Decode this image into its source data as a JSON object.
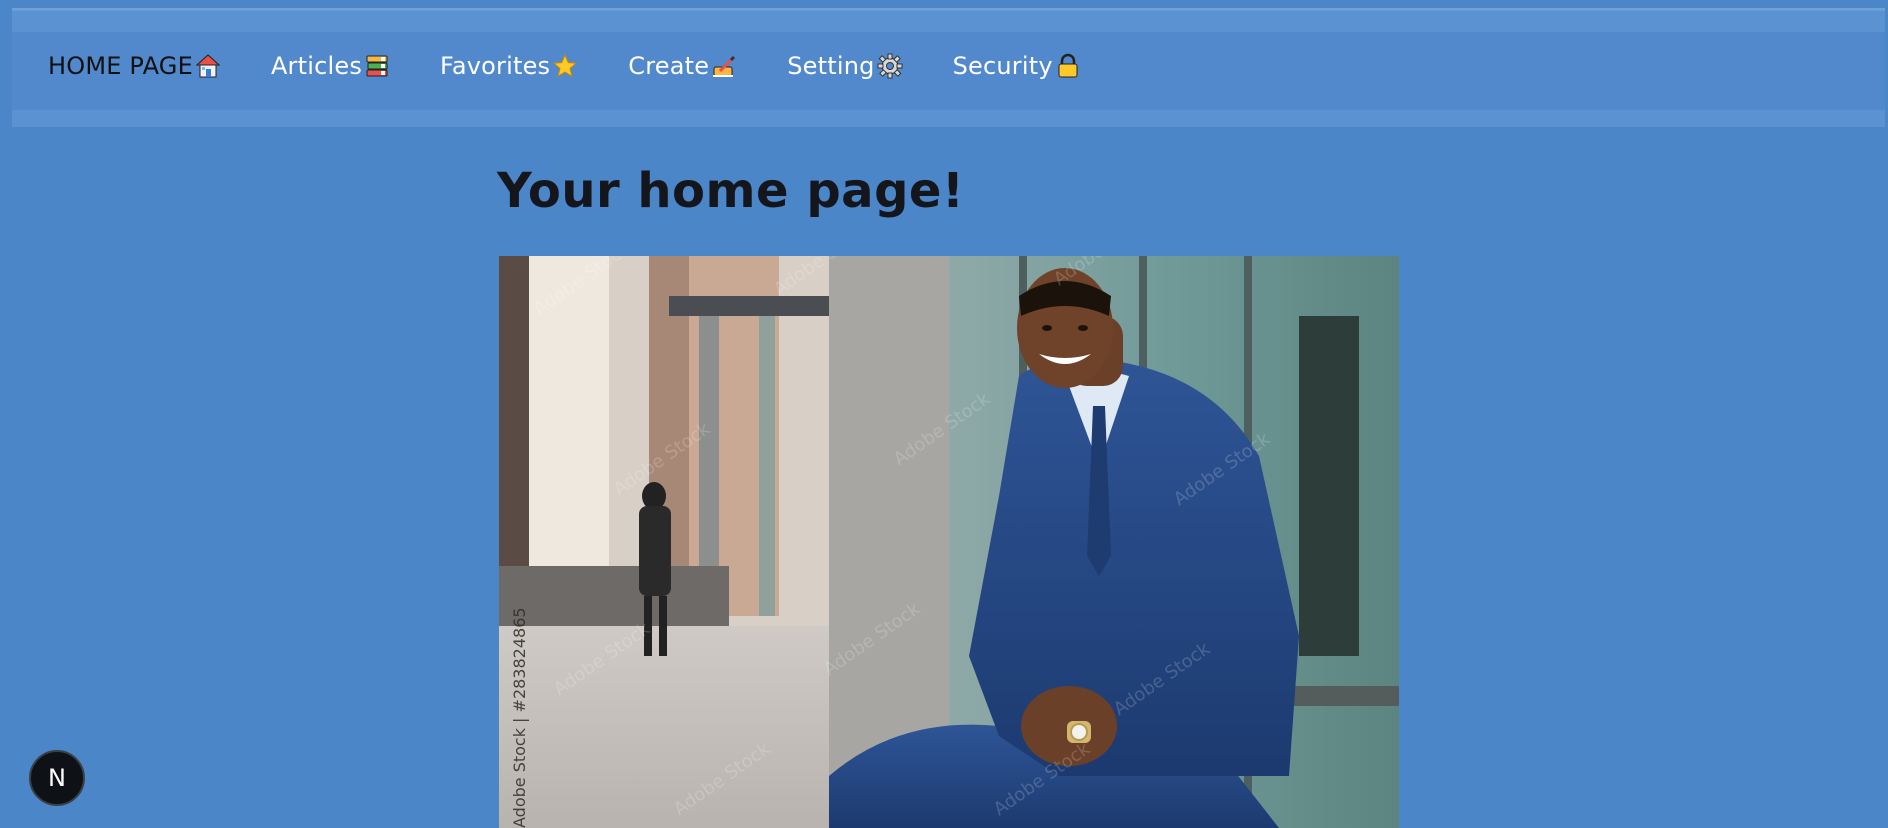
{
  "nav": {
    "items": [
      {
        "label": "HOME PAGE",
        "icon": "house-icon",
        "active": true
      },
      {
        "label": "Articles",
        "icon": "books-icon"
      },
      {
        "label": "Favorites",
        "icon": "star-icon"
      },
      {
        "label": "Create",
        "icon": "writing-hand-icon"
      },
      {
        "label": "Setting",
        "icon": "gear-icon"
      },
      {
        "label": "Security",
        "icon": "lock-icon"
      }
    ]
  },
  "main": {
    "title": "Your home page!",
    "hero_image": {
      "description_icon": "businessman-photo",
      "watermark_text": "Adobe Stock | #283824865"
    }
  },
  "dev_badge": {
    "label": "N"
  },
  "colors": {
    "background": "#4a86c8",
    "navbar": "#5288cc",
    "title_text": "#14161b",
    "nav_text": "#ffffff",
    "nav_active_text": "#111111"
  }
}
